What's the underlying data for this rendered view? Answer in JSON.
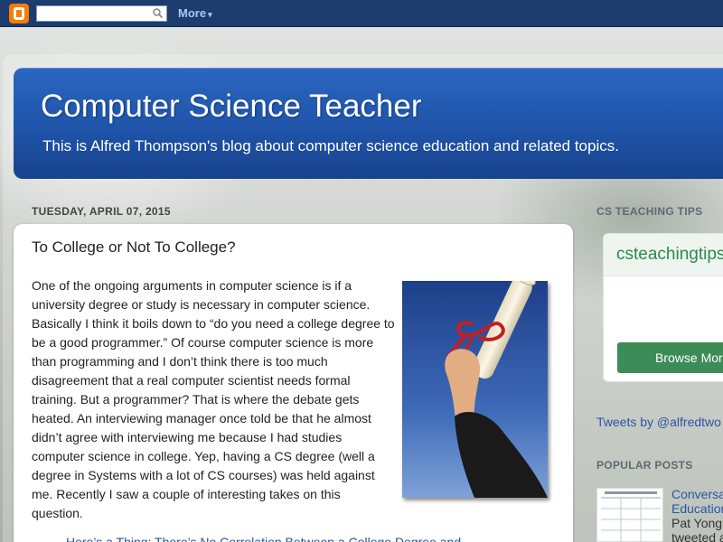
{
  "navbar": {
    "search_placeholder": "",
    "more_label": "More",
    "caret": "▾"
  },
  "header": {
    "title": "Computer Science Teacher",
    "description": "This is Alfred Thompson's blog about computer science education and related topics."
  },
  "post": {
    "date": "TUESDAY, APRIL 07, 2015",
    "title": "To College or Not To College?",
    "body": "One of the ongoing arguments in computer science is if a university degree or study is necessary in computer science. Basically I think it boils down to “do you need a college degree to be a good programmer.” Of course computer science is more than programming and I don’t think there is too much disagreement that a real computer scientist needs formal training. But a programmer? That is where the debate gets heated. An interviewing manager once told be that he almost didn’t agree with interviewing me because I had studies computer science in college. Yep, having a CS degree (well a degree in Systems with a lot of CS courses) was held against me. Recently I saw a couple of interesting takes on this question.",
    "link_text": "Here’s a Thing: There’s No Correlation Between a College Degree and"
  },
  "sidebar": {
    "tips_heading": "CS TEACHING TIPS",
    "tips_widget_title": "csteachingtips",
    "browse_button": "Browse More",
    "tweets_link": "Tweets by @alfredtwo",
    "popular_heading": "POPULAR POSTS",
    "popular_title_1": "Conversa",
    "popular_title_2": "Education",
    "popular_snippet_1": "Pat Yongp",
    "popular_snippet_2": "tweeted a"
  },
  "colors": {
    "navbar": "#1c3c6e",
    "header_blue": "#1f54a9",
    "blogger_orange": "#f57d00",
    "link_blue": "#2a55a5",
    "tips_green": "#2b8a4e"
  }
}
